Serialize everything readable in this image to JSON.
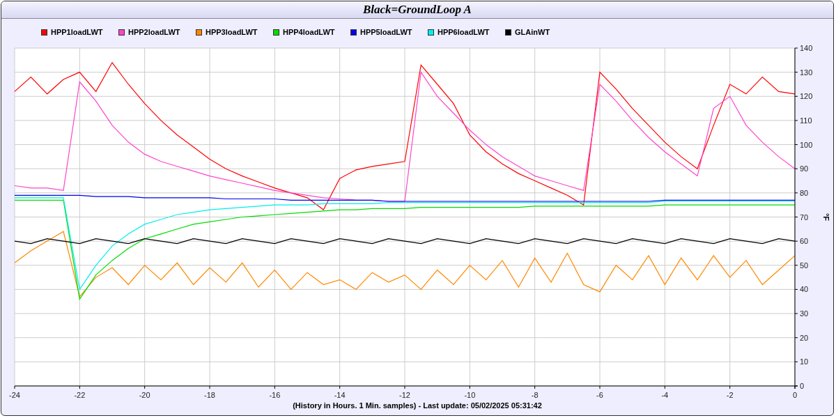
{
  "window": {
    "title": "Black=GroundLoop A"
  },
  "chart": {
    "chart_data": {
      "type": "line",
      "xlabel": "(History in Hours. 1 Min. samples) - Last update: 05/02/2025 05:31:42",
      "ylabel": "°F",
      "x": [
        -24,
        -23.5,
        -23,
        -22.5,
        -22,
        -21.5,
        -21,
        -20.5,
        -20,
        -19.5,
        -19,
        -18.5,
        -18,
        -17.5,
        -17,
        -16.5,
        -16,
        -15.5,
        -15,
        -14.5,
        -14,
        -13.5,
        -13,
        -12.5,
        -12,
        -11.5,
        -11,
        -10.5,
        -10,
        -9.5,
        -9,
        -8.5,
        -8,
        -7.5,
        -7,
        -6.5,
        -6,
        -5.5,
        -5,
        -4.5,
        -4,
        -3.5,
        -3,
        -2.5,
        -2,
        -1.5,
        -1,
        -0.5,
        0
      ],
      "grid": true,
      "xlim": [
        -24,
        0
      ],
      "ylim": [
        0,
        140
      ],
      "xticks": [
        -24,
        -22,
        -20,
        -18,
        -16,
        -14,
        -12,
        -10,
        -8,
        -6,
        -4,
        -2,
        0
      ],
      "yticks": [
        0,
        10,
        20,
        30,
        40,
        50,
        60,
        70,
        80,
        90,
        100,
        110,
        120,
        130,
        140
      ],
      "series": [
        {
          "name": "HPP1loadLWT",
          "color": "#ff0000",
          "values": [
            122,
            128,
            121,
            127,
            130,
            122,
            134,
            125,
            117,
            110,
            104,
            99,
            94,
            90,
            87,
            84.5,
            82,
            80,
            78,
            73,
            86,
            89.5,
            91,
            92,
            93,
            133,
            125,
            117,
            104,
            97,
            92,
            88,
            85,
            82,
            79,
            75,
            130,
            123,
            115,
            108,
            101,
            95,
            90,
            108,
            125,
            121,
            128,
            122,
            121
          ]
        },
        {
          "name": "HPP2loadLWT",
          "color": "#ff44cc",
          "values": [
            83,
            82,
            82,
            81,
            126,
            118,
            108,
            101,
            96,
            93,
            91,
            89,
            87,
            85.5,
            84,
            82.5,
            81,
            80,
            79,
            78,
            77.5,
            77,
            77,
            76.5,
            76.5,
            130,
            120,
            113,
            106,
            100,
            95,
            91,
            87,
            85,
            83,
            81,
            125,
            118,
            110,
            103,
            97,
            92,
            87,
            115,
            120,
            108,
            101,
            95,
            90
          ]
        },
        {
          "name": "HPP3loadLWT",
          "color": "#ff8800",
          "values": [
            51,
            56,
            60,
            64,
            37,
            45,
            49,
            42,
            50,
            44,
            51,
            42,
            49,
            43,
            51,
            41,
            48,
            40,
            47,
            42,
            44,
            40,
            47,
            43,
            46,
            40,
            48,
            42,
            50,
            44,
            52,
            41,
            53,
            43,
            55,
            42,
            39,
            50,
            44,
            54,
            42,
            53,
            44,
            54,
            45,
            52,
            42,
            48,
            54
          ]
        },
        {
          "name": "HPP4loadLWT",
          "color": "#00dd00",
          "values": [
            77,
            77,
            77,
            77,
            36,
            46,
            52,
            57,
            61,
            63,
            65,
            67,
            68,
            69,
            70,
            70.5,
            71,
            71.5,
            72,
            72.5,
            73,
            73,
            73.5,
            73.5,
            73.5,
            74,
            74,
            74,
            74,
            74,
            74,
            74,
            74.5,
            74.5,
            74.5,
            74.5,
            74.5,
            74.5,
            74.5,
            74.5,
            75,
            75,
            75,
            75,
            75,
            75,
            75,
            75,
            75
          ]
        },
        {
          "name": "HPP5loadLWT",
          "color": "#0000ee",
          "values": [
            79,
            79,
            79,
            79,
            79,
            78.5,
            78.5,
            78.5,
            78,
            78,
            78,
            78,
            78,
            77.5,
            77.5,
            77.5,
            77.5,
            77,
            77,
            77,
            77,
            77,
            77,
            76.5,
            76.5,
            76.5,
            76.5,
            76.5,
            76.5,
            76.5,
            76.5,
            76.5,
            76.5,
            76.5,
            76.5,
            76.5,
            76.5,
            76.5,
            76.5,
            76.5,
            77,
            77,
            77,
            77,
            77,
            77,
            77,
            77,
            77
          ]
        },
        {
          "name": "HPP6loadLWT",
          "color": "#00eeee",
          "values": [
            78,
            78,
            78,
            78,
            40,
            50,
            58,
            63,
            67,
            69,
            71,
            72,
            73,
            73.5,
            74,
            74.5,
            75,
            75,
            75,
            75.5,
            75.5,
            75.5,
            75.5,
            76,
            76,
            76,
            76,
            76,
            76,
            76,
            76,
            76,
            76,
            76,
            76,
            76,
            76,
            76,
            76,
            76,
            76.5,
            76.5,
            76.5,
            76.5,
            76.5,
            76.5,
            76.5,
            76.5,
            76.5
          ]
        },
        {
          "name": "GLAinWT",
          "color": "#000000",
          "values": [
            60,
            59,
            61,
            60,
            59,
            61,
            60,
            59,
            61,
            60,
            59,
            61,
            60,
            59,
            61,
            60,
            59,
            61,
            60,
            59,
            61,
            60,
            59,
            61,
            60,
            59,
            61,
            60,
            59,
            61,
            60,
            59,
            61,
            60,
            59,
            61,
            60,
            59,
            61,
            60,
            59,
            61,
            60,
            59,
            61,
            60,
            59,
            61,
            60
          ]
        }
      ]
    }
  }
}
